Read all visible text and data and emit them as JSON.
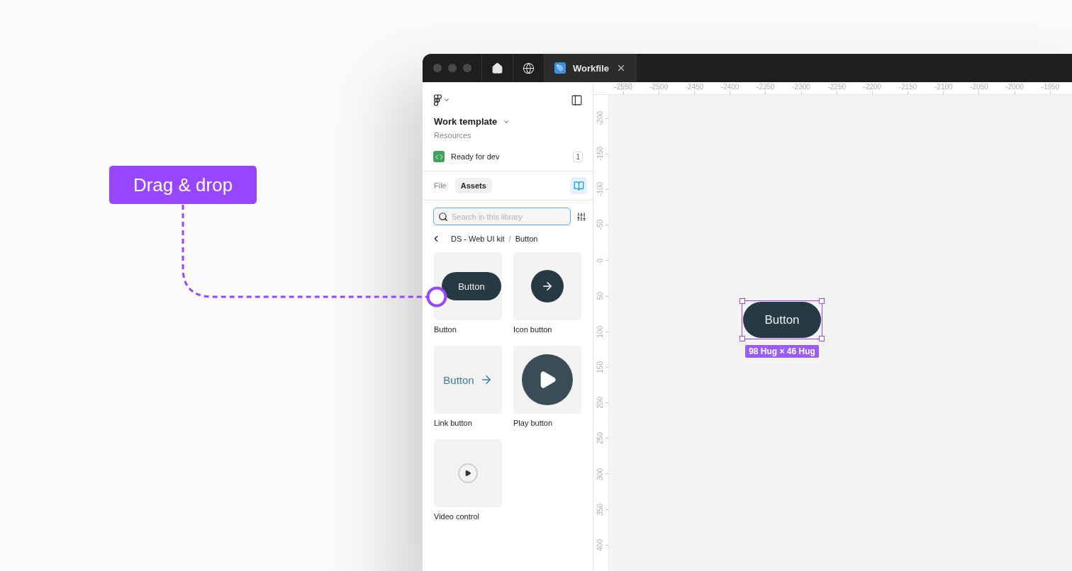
{
  "callout": {
    "label": "Drag & drop"
  },
  "window": {
    "tabs": [
      {
        "kind": "home",
        "selected": false
      },
      {
        "kind": "globe",
        "selected": false
      },
      {
        "kind": "file",
        "label": "Workfile",
        "selected": true
      }
    ]
  },
  "sidebar": {
    "file_name": "Work template",
    "subtitle": "Resources",
    "status": {
      "label": "Ready for dev",
      "count": "1"
    },
    "tabs": [
      {
        "label": "File",
        "selected": false
      },
      {
        "label": "Assets",
        "selected": true
      }
    ],
    "search": {
      "placeholder": "Search in this library"
    },
    "breadcrumb": {
      "items": [
        "DS - Web UI kit",
        "Button"
      ],
      "separator": "/"
    },
    "components": [
      {
        "name": "Button",
        "kind": "button",
        "preview_label": "Button"
      },
      {
        "name": "Icon button",
        "kind": "icon-button"
      },
      {
        "name": "Link button",
        "kind": "link-button",
        "preview_label": "Button"
      },
      {
        "name": "Play button",
        "kind": "play-button"
      },
      {
        "name": "Video control",
        "kind": "video-control"
      }
    ]
  },
  "rulers": {
    "x_ticks": [
      "-2550",
      "-2500",
      "-2450",
      "-2400",
      "-2350",
      "-2300",
      "-2250",
      "-2200",
      "-2150",
      "-2100",
      "-2050",
      "-2000",
      "-1950"
    ],
    "y_ticks": [
      "-200",
      "-150",
      "-100",
      "-50",
      "0",
      "50",
      "100",
      "150",
      "200",
      "250",
      "300",
      "350",
      "400"
    ]
  },
  "canvas": {
    "selection": {
      "label": "Button",
      "size": "98 Hug × 46 Hug"
    }
  }
}
